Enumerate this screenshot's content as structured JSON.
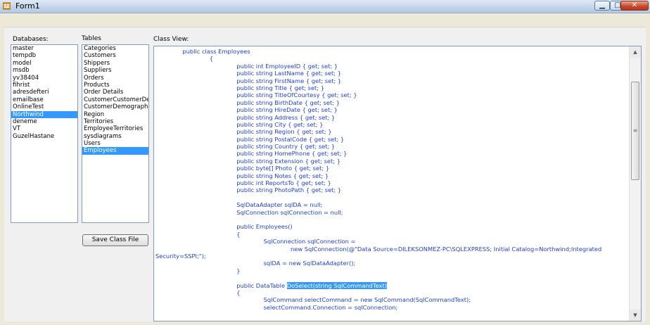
{
  "window": {
    "title": "Form1"
  },
  "labels": {
    "databases": "Databases:",
    "tables": "Tables",
    "class_view": "Class View:"
  },
  "databases": {
    "items": [
      "master",
      "tempdb",
      "model",
      "msdb",
      "yv38404",
      "fihrist",
      "adresdefteri",
      "emailbase",
      "OnlineTest",
      "Northwind",
      "deneme",
      "VT",
      "GuzelHastane"
    ],
    "selected": "Northwind"
  },
  "tables": {
    "items": [
      "Categories",
      "Customers",
      "Shippers",
      "Suppliers",
      "Orders",
      "Products",
      "Order Details",
      "CustomerCustomerDemo",
      "CustomerDemographics",
      "Region",
      "Territories",
      "EmployeeTerritories",
      "sysdiagrams",
      "Users",
      "Employees"
    ],
    "selected": "Employees"
  },
  "buttons": {
    "save_class_file": "Save Class File"
  },
  "code": {
    "lines": [
      {
        "indent": 8,
        "text": "public class Employees"
      },
      {
        "indent": 16,
        "text": "{"
      },
      {
        "indent": 24,
        "text": "public int EmployeeID { get; set; }"
      },
      {
        "indent": 24,
        "text": "public string LastName { get; set; }"
      },
      {
        "indent": 24,
        "text": "public string FirstName { get; set; }"
      },
      {
        "indent": 24,
        "text": "public string Title { get; set; }"
      },
      {
        "indent": 24,
        "text": "public string TitleOfCourtesy { get; set; }"
      },
      {
        "indent": 24,
        "text": "public string BirthDate { get; set; }"
      },
      {
        "indent": 24,
        "text": "public string HireDate { get; set; }"
      },
      {
        "indent": 24,
        "text": "public string Address { get; set; }"
      },
      {
        "indent": 24,
        "text": "public string City { get; set; }"
      },
      {
        "indent": 24,
        "text": "public string Region { get; set; }"
      },
      {
        "indent": 24,
        "text": "public string PostalCode { get; set; }"
      },
      {
        "indent": 24,
        "text": "public string Country { get; set; }"
      },
      {
        "indent": 24,
        "text": "public string HomePhone { get; set; }"
      },
      {
        "indent": 24,
        "text": "public string Extension { get; set; }"
      },
      {
        "indent": 24,
        "text": "public byte[] Photo { get; set; }"
      },
      {
        "indent": 24,
        "text": "public string Notes { get; set; }"
      },
      {
        "indent": 24,
        "text": "public int ReportsTo { get; set; }"
      },
      {
        "indent": 24,
        "text": "public string PhotoPath { get; set; }"
      },
      {
        "indent": 0,
        "text": ""
      },
      {
        "indent": 24,
        "text": "SqlDataAdapter sqlDA = null;"
      },
      {
        "indent": 24,
        "text": "SqlConnection sqlConnection = null;"
      },
      {
        "indent": 0,
        "text": ""
      },
      {
        "indent": 24,
        "text": "public Employees()"
      },
      {
        "indent": 24,
        "text": "{"
      },
      {
        "indent": 32,
        "text": "SqlConnection sqlConnection ="
      },
      {
        "indent": 40,
        "text": "new SqlConnection(@\"Data Source=DILEKSONMEZ-PC\\SQLEXPRESS; Initial Catalog=Northwind;Integrated"
      },
      {
        "indent": 0,
        "text": "Security=SSPI;\");"
      },
      {
        "indent": 32,
        "text": "sqlDA = new SqlDataAdapter();"
      },
      {
        "indent": 24,
        "text": "}"
      },
      {
        "indent": 0,
        "text": ""
      },
      {
        "indent": 24,
        "text": "public DataTable ",
        "highlight": "DoSelect(string SqlCommandText)"
      },
      {
        "indent": 24,
        "text": "{"
      },
      {
        "indent": 32,
        "text": "SqlCommand selectCommand = new SqlCommand(SqlCommandText);"
      },
      {
        "indent": 32,
        "text": "selectCommand.Connection = sqlConnection;"
      }
    ]
  }
}
